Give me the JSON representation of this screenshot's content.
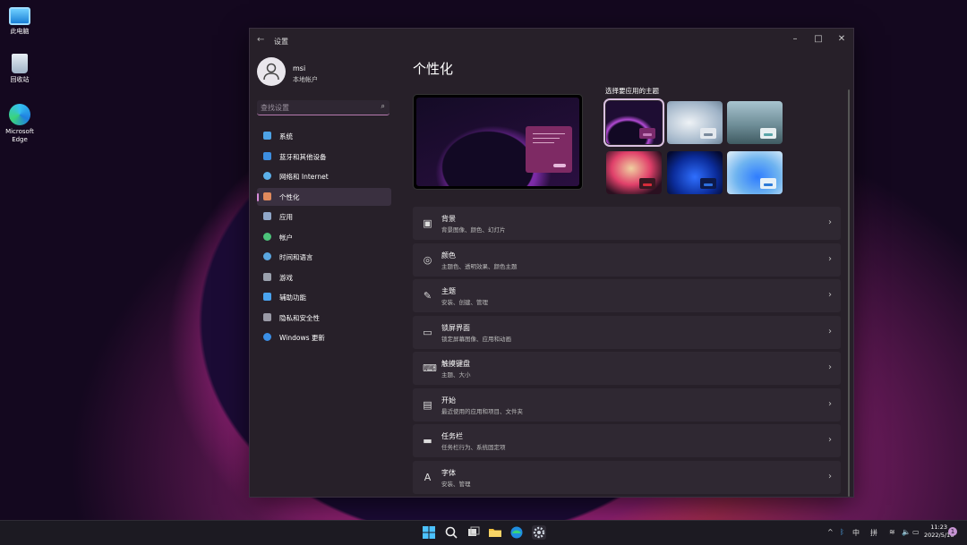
{
  "desktop": {
    "icons": [
      {
        "label": "此电脑",
        "icon": "computer-icon"
      },
      {
        "label": "回收站",
        "icon": "recycle-bin-icon"
      },
      {
        "label": "Microsoft Edge",
        "icon": "edge-icon"
      }
    ]
  },
  "window": {
    "title": "设置",
    "controls": {
      "minimize": "–",
      "maximize": "□",
      "close": "✕"
    },
    "profile": {
      "name": "msi",
      "subtitle": "本地帐户"
    },
    "search": {
      "placeholder": "查找设置"
    },
    "nav": [
      {
        "label": "系统",
        "icon": "system-icon",
        "color": "#4ea3e6"
      },
      {
        "label": "蓝牙和其他设备",
        "icon": "bluetooth-icon",
        "color": "#3d8ee0"
      },
      {
        "label": "网络和 Internet",
        "icon": "network-icon",
        "color": "#5cb0ea"
      },
      {
        "label": "个性化",
        "icon": "brush-icon",
        "color": "#e08a5c",
        "active": true
      },
      {
        "label": "应用",
        "icon": "apps-icon",
        "color": "#8fa6c8"
      },
      {
        "label": "帐户",
        "icon": "account-icon",
        "color": "#4cc37a"
      },
      {
        "label": "时间和语言",
        "icon": "time-language-icon",
        "color": "#5aa6e0"
      },
      {
        "label": "游戏",
        "icon": "gaming-icon",
        "color": "#9aa0ac"
      },
      {
        "label": "辅助功能",
        "icon": "accessibility-icon",
        "color": "#4aa3ef"
      },
      {
        "label": "隐私和安全性",
        "icon": "shield-icon",
        "color": "#9a9aa6"
      },
      {
        "label": "Windows 更新",
        "icon": "windows-update-icon",
        "color": "#3b8fe6"
      }
    ],
    "page_title": "个性化",
    "themes_label": "选择要应用的主题",
    "themes": [
      {
        "name": "theme-glow-dark",
        "selected": true
      },
      {
        "name": "theme-captured-motion"
      },
      {
        "name": "theme-sunrise"
      },
      {
        "name": "theme-flow"
      },
      {
        "name": "theme-windows-dark"
      },
      {
        "name": "theme-windows-light"
      }
    ],
    "rows": [
      {
        "title": "背景",
        "subtitle": "背景图像、颜色、幻灯片",
        "icon": "image-icon"
      },
      {
        "title": "颜色",
        "subtitle": "主题色、透明效果、颜色主题",
        "icon": "palette-icon"
      },
      {
        "title": "主题",
        "subtitle": "安装、创建、管理",
        "icon": "brush-icon"
      },
      {
        "title": "锁屏界面",
        "subtitle": "锁定屏幕图像、应用和动画",
        "icon": "lock-screen-icon"
      },
      {
        "title": "触摸键盘",
        "subtitle": "主题、大小",
        "icon": "keyboard-icon"
      },
      {
        "title": "开始",
        "subtitle": "最近使用的应用和项目、文件夹",
        "icon": "start-icon"
      },
      {
        "title": "任务栏",
        "subtitle": "任务栏行为、系统固定项",
        "icon": "taskbar-icon"
      },
      {
        "title": "字体",
        "subtitle": "安装、管理",
        "icon": "font-icon"
      }
    ]
  },
  "taskbar": {
    "apps": [
      "start-icon",
      "search-icon",
      "task-view-icon",
      "file-explorer-icon",
      "edge-icon",
      "settings-icon"
    ],
    "tray": {
      "ime_mode": "中",
      "ime": "拼"
    },
    "clock": {
      "time": "11:23",
      "date": "2022/5/16"
    },
    "notifications": "1"
  }
}
